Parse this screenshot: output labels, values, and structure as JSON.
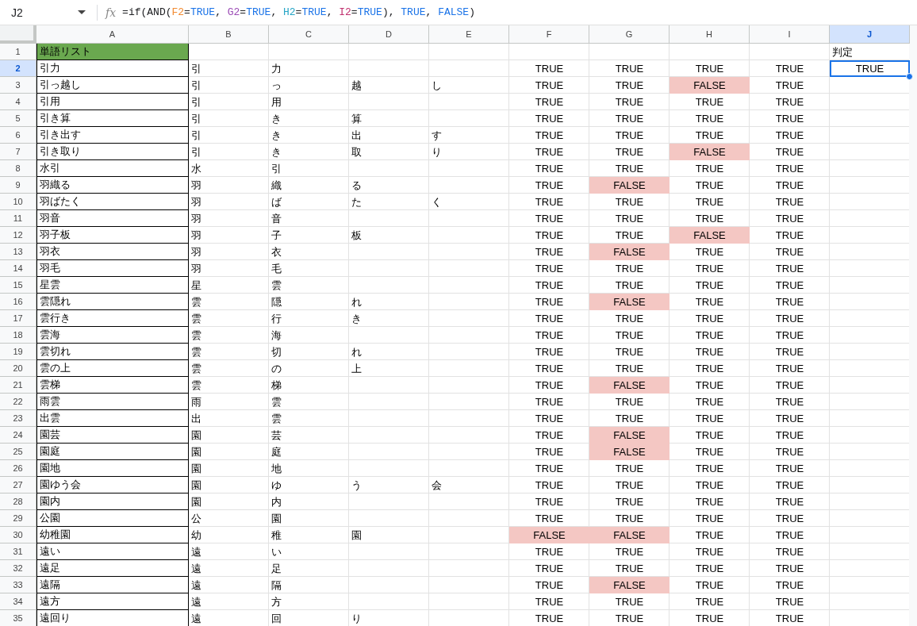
{
  "name_box": {
    "value": "J2"
  },
  "formula_bar": {
    "fx_label": "fx",
    "tokens": [
      {
        "text": "=if(AND("
      },
      {
        "text": "F2",
        "color": "#f28b31"
      },
      {
        "text": "="
      },
      {
        "text": "TRUE",
        "color": "#1a73e8"
      },
      {
        "text": ", "
      },
      {
        "text": "G2",
        "color": "#9c4cb6"
      },
      {
        "text": "="
      },
      {
        "text": "TRUE",
        "color": "#1a73e8"
      },
      {
        "text": ", "
      },
      {
        "text": "H2",
        "color": "#26a5c6"
      },
      {
        "text": "="
      },
      {
        "text": "TRUE",
        "color": "#1a73e8"
      },
      {
        "text": ", "
      },
      {
        "text": "I2",
        "color": "#c0306e"
      },
      {
        "text": "="
      },
      {
        "text": "TRUE",
        "color": "#1a73e8"
      },
      {
        "text": "), "
      },
      {
        "text": "TRUE",
        "color": "#1a73e8"
      },
      {
        "text": ", "
      },
      {
        "text": "FALSE",
        "color": "#1a73e8"
      },
      {
        "text": ")"
      }
    ]
  },
  "columns": [
    {
      "label": "A",
      "selected": false
    },
    {
      "label": "B",
      "selected": false
    },
    {
      "label": "C",
      "selected": false
    },
    {
      "label": "D",
      "selected": false
    },
    {
      "label": "E",
      "selected": false
    },
    {
      "label": "F",
      "selected": false
    },
    {
      "label": "G",
      "selected": false
    },
    {
      "label": "H",
      "selected": false
    },
    {
      "label": "I",
      "selected": false
    },
    {
      "label": "J",
      "selected": true
    }
  ],
  "title_row": {
    "number": "1",
    "selected": false,
    "title": "単語リスト",
    "label": "判定"
  },
  "rows": [
    {
      "number": "2",
      "selected": true,
      "word": "引力",
      "parts": [
        "引",
        "力"
      ],
      "checks": [
        {
          "text": "TRUE",
          "highlighted": false
        },
        {
          "text": "TRUE",
          "highlighted": false
        },
        {
          "text": "TRUE",
          "highlighted": false
        },
        {
          "text": "TRUE",
          "highlighted": false
        }
      ],
      "result": "TRUE"
    },
    {
      "number": "3",
      "selected": false,
      "word": "引っ越し",
      "parts": [
        "引",
        "っ",
        "越",
        "し"
      ],
      "checks": [
        {
          "text": "TRUE",
          "highlighted": false
        },
        {
          "text": "TRUE",
          "highlighted": false
        },
        {
          "text": "FALSE",
          "highlighted": true
        },
        {
          "text": "TRUE",
          "highlighted": false
        }
      ]
    },
    {
      "number": "4",
      "selected": false,
      "word": "引用",
      "parts": [
        "引",
        "用"
      ],
      "checks": [
        {
          "text": "TRUE",
          "highlighted": false
        },
        {
          "text": "TRUE",
          "highlighted": false
        },
        {
          "text": "TRUE",
          "highlighted": false
        },
        {
          "text": "TRUE",
          "highlighted": false
        }
      ]
    },
    {
      "number": "5",
      "selected": false,
      "word": "引き算",
      "parts": [
        "引",
        "き",
        "算"
      ],
      "checks": [
        {
          "text": "TRUE",
          "highlighted": false
        },
        {
          "text": "TRUE",
          "highlighted": false
        },
        {
          "text": "TRUE",
          "highlighted": false
        },
        {
          "text": "TRUE",
          "highlighted": false
        }
      ]
    },
    {
      "number": "6",
      "selected": false,
      "word": "引き出す",
      "parts": [
        "引",
        "き",
        "出",
        "す"
      ],
      "checks": [
        {
          "text": "TRUE",
          "highlighted": false
        },
        {
          "text": "TRUE",
          "highlighted": false
        },
        {
          "text": "TRUE",
          "highlighted": false
        },
        {
          "text": "TRUE",
          "highlighted": false
        }
      ]
    },
    {
      "number": "7",
      "selected": false,
      "word": "引き取り",
      "parts": [
        "引",
        "き",
        "取",
        "り"
      ],
      "checks": [
        {
          "text": "TRUE",
          "highlighted": false
        },
        {
          "text": "TRUE",
          "highlighted": false
        },
        {
          "text": "FALSE",
          "highlighted": true
        },
        {
          "text": "TRUE",
          "highlighted": false
        }
      ]
    },
    {
      "number": "8",
      "selected": false,
      "word": "水引",
      "parts": [
        "水",
        "引"
      ],
      "checks": [
        {
          "text": "TRUE",
          "highlighted": false
        },
        {
          "text": "TRUE",
          "highlighted": false
        },
        {
          "text": "TRUE",
          "highlighted": false
        },
        {
          "text": "TRUE",
          "highlighted": false
        }
      ]
    },
    {
      "number": "9",
      "selected": false,
      "word": "羽織る",
      "parts": [
        "羽",
        "織",
        "る"
      ],
      "checks": [
        {
          "text": "TRUE",
          "highlighted": false
        },
        {
          "text": "FALSE",
          "highlighted": true
        },
        {
          "text": "TRUE",
          "highlighted": false
        },
        {
          "text": "TRUE",
          "highlighted": false
        }
      ]
    },
    {
      "number": "10",
      "selected": false,
      "word": "羽ばたく",
      "parts": [
        "羽",
        "ば",
        "た",
        "く"
      ],
      "checks": [
        {
          "text": "TRUE",
          "highlighted": false
        },
        {
          "text": "TRUE",
          "highlighted": false
        },
        {
          "text": "TRUE",
          "highlighted": false
        },
        {
          "text": "TRUE",
          "highlighted": false
        }
      ]
    },
    {
      "number": "11",
      "selected": false,
      "word": "羽音",
      "parts": [
        "羽",
        "音"
      ],
      "checks": [
        {
          "text": "TRUE",
          "highlighted": false
        },
        {
          "text": "TRUE",
          "highlighted": false
        },
        {
          "text": "TRUE",
          "highlighted": false
        },
        {
          "text": "TRUE",
          "highlighted": false
        }
      ]
    },
    {
      "number": "12",
      "selected": false,
      "word": "羽子板",
      "parts": [
        "羽",
        "子",
        "板"
      ],
      "checks": [
        {
          "text": "TRUE",
          "highlighted": false
        },
        {
          "text": "TRUE",
          "highlighted": false
        },
        {
          "text": "FALSE",
          "highlighted": true
        },
        {
          "text": "TRUE",
          "highlighted": false
        }
      ]
    },
    {
      "number": "13",
      "selected": false,
      "word": "羽衣",
      "parts": [
        "羽",
        "衣"
      ],
      "checks": [
        {
          "text": "TRUE",
          "highlighted": false
        },
        {
          "text": "FALSE",
          "highlighted": true
        },
        {
          "text": "TRUE",
          "highlighted": false
        },
        {
          "text": "TRUE",
          "highlighted": false
        }
      ]
    },
    {
      "number": "14",
      "selected": false,
      "word": "羽毛",
      "parts": [
        "羽",
        "毛"
      ],
      "checks": [
        {
          "text": "TRUE",
          "highlighted": false
        },
        {
          "text": "TRUE",
          "highlighted": false
        },
        {
          "text": "TRUE",
          "highlighted": false
        },
        {
          "text": "TRUE",
          "highlighted": false
        }
      ]
    },
    {
      "number": "15",
      "selected": false,
      "word": "星雲",
      "parts": [
        "星",
        "雲"
      ],
      "checks": [
        {
          "text": "TRUE",
          "highlighted": false
        },
        {
          "text": "TRUE",
          "highlighted": false
        },
        {
          "text": "TRUE",
          "highlighted": false
        },
        {
          "text": "TRUE",
          "highlighted": false
        }
      ]
    },
    {
      "number": "16",
      "selected": false,
      "word": "雲隠れ",
      "parts": [
        "雲",
        "隠",
        "れ"
      ],
      "checks": [
        {
          "text": "TRUE",
          "highlighted": false
        },
        {
          "text": "FALSE",
          "highlighted": true
        },
        {
          "text": "TRUE",
          "highlighted": false
        },
        {
          "text": "TRUE",
          "highlighted": false
        }
      ]
    },
    {
      "number": "17",
      "selected": false,
      "word": "雲行き",
      "parts": [
        "雲",
        "行",
        "き"
      ],
      "checks": [
        {
          "text": "TRUE",
          "highlighted": false
        },
        {
          "text": "TRUE",
          "highlighted": false
        },
        {
          "text": "TRUE",
          "highlighted": false
        },
        {
          "text": "TRUE",
          "highlighted": false
        }
      ]
    },
    {
      "number": "18",
      "selected": false,
      "word": "雲海",
      "parts": [
        "雲",
        "海"
      ],
      "checks": [
        {
          "text": "TRUE",
          "highlighted": false
        },
        {
          "text": "TRUE",
          "highlighted": false
        },
        {
          "text": "TRUE",
          "highlighted": false
        },
        {
          "text": "TRUE",
          "highlighted": false
        }
      ]
    },
    {
      "number": "19",
      "selected": false,
      "word": "雲切れ",
      "parts": [
        "雲",
        "切",
        "れ"
      ],
      "checks": [
        {
          "text": "TRUE",
          "highlighted": false
        },
        {
          "text": "TRUE",
          "highlighted": false
        },
        {
          "text": "TRUE",
          "highlighted": false
        },
        {
          "text": "TRUE",
          "highlighted": false
        }
      ]
    },
    {
      "number": "20",
      "selected": false,
      "word": "雲の上",
      "parts": [
        "雲",
        "の",
        "上"
      ],
      "checks": [
        {
          "text": "TRUE",
          "highlighted": false
        },
        {
          "text": "TRUE",
          "highlighted": false
        },
        {
          "text": "TRUE",
          "highlighted": false
        },
        {
          "text": "TRUE",
          "highlighted": false
        }
      ]
    },
    {
      "number": "21",
      "selected": false,
      "word": "雲梯",
      "parts": [
        "雲",
        "梯"
      ],
      "checks": [
        {
          "text": "TRUE",
          "highlighted": false
        },
        {
          "text": "FALSE",
          "highlighted": true
        },
        {
          "text": "TRUE",
          "highlighted": false
        },
        {
          "text": "TRUE",
          "highlighted": false
        }
      ]
    },
    {
      "number": "22",
      "selected": false,
      "word": "雨雲",
      "parts": [
        "雨",
        "雲"
      ],
      "checks": [
        {
          "text": "TRUE",
          "highlighted": false
        },
        {
          "text": "TRUE",
          "highlighted": false
        },
        {
          "text": "TRUE",
          "highlighted": false
        },
        {
          "text": "TRUE",
          "highlighted": false
        }
      ]
    },
    {
      "number": "23",
      "selected": false,
      "word": "出雲",
      "parts": [
        "出",
        "雲"
      ],
      "checks": [
        {
          "text": "TRUE",
          "highlighted": false
        },
        {
          "text": "TRUE",
          "highlighted": false
        },
        {
          "text": "TRUE",
          "highlighted": false
        },
        {
          "text": "TRUE",
          "highlighted": false
        }
      ]
    },
    {
      "number": "24",
      "selected": false,
      "word": "園芸",
      "parts": [
        "園",
        "芸"
      ],
      "checks": [
        {
          "text": "TRUE",
          "highlighted": false
        },
        {
          "text": "FALSE",
          "highlighted": true
        },
        {
          "text": "TRUE",
          "highlighted": false
        },
        {
          "text": "TRUE",
          "highlighted": false
        }
      ]
    },
    {
      "number": "25",
      "selected": false,
      "word": "園庭",
      "parts": [
        "園",
        "庭"
      ],
      "checks": [
        {
          "text": "TRUE",
          "highlighted": false
        },
        {
          "text": "FALSE",
          "highlighted": true
        },
        {
          "text": "TRUE",
          "highlighted": false
        },
        {
          "text": "TRUE",
          "highlighted": false
        }
      ]
    },
    {
      "number": "26",
      "selected": false,
      "word": "園地",
      "parts": [
        "園",
        "地"
      ],
      "checks": [
        {
          "text": "TRUE",
          "highlighted": false
        },
        {
          "text": "TRUE",
          "highlighted": false
        },
        {
          "text": "TRUE",
          "highlighted": false
        },
        {
          "text": "TRUE",
          "highlighted": false
        }
      ]
    },
    {
      "number": "27",
      "selected": false,
      "word": "園ゆう会",
      "parts": [
        "園",
        "ゆ",
        "う",
        "会"
      ],
      "checks": [
        {
          "text": "TRUE",
          "highlighted": false
        },
        {
          "text": "TRUE",
          "highlighted": false
        },
        {
          "text": "TRUE",
          "highlighted": false
        },
        {
          "text": "TRUE",
          "highlighted": false
        }
      ]
    },
    {
      "number": "28",
      "selected": false,
      "word": "園内",
      "parts": [
        "園",
        "内"
      ],
      "checks": [
        {
          "text": "TRUE",
          "highlighted": false
        },
        {
          "text": "TRUE",
          "highlighted": false
        },
        {
          "text": "TRUE",
          "highlighted": false
        },
        {
          "text": "TRUE",
          "highlighted": false
        }
      ]
    },
    {
      "number": "29",
      "selected": false,
      "word": "公園",
      "parts": [
        "公",
        "園"
      ],
      "checks": [
        {
          "text": "TRUE",
          "highlighted": false
        },
        {
          "text": "TRUE",
          "highlighted": false
        },
        {
          "text": "TRUE",
          "highlighted": false
        },
        {
          "text": "TRUE",
          "highlighted": false
        }
      ]
    },
    {
      "number": "30",
      "selected": false,
      "word": "幼稚園",
      "parts": [
        "幼",
        "稚",
        "園"
      ],
      "checks": [
        {
          "text": "FALSE",
          "highlighted": true
        },
        {
          "text": "FALSE",
          "highlighted": true
        },
        {
          "text": "TRUE",
          "highlighted": false
        },
        {
          "text": "TRUE",
          "highlighted": false
        }
      ]
    },
    {
      "number": "31",
      "selected": false,
      "word": "遠い",
      "parts": [
        "遠",
        "い"
      ],
      "checks": [
        {
          "text": "TRUE",
          "highlighted": false
        },
        {
          "text": "TRUE",
          "highlighted": false
        },
        {
          "text": "TRUE",
          "highlighted": false
        },
        {
          "text": "TRUE",
          "highlighted": false
        }
      ]
    },
    {
      "number": "32",
      "selected": false,
      "word": "遠足",
      "parts": [
        "遠",
        "足"
      ],
      "checks": [
        {
          "text": "TRUE",
          "highlighted": false
        },
        {
          "text": "TRUE",
          "highlighted": false
        },
        {
          "text": "TRUE",
          "highlighted": false
        },
        {
          "text": "TRUE",
          "highlighted": false
        }
      ]
    },
    {
      "number": "33",
      "selected": false,
      "word": "遠隔",
      "parts": [
        "遠",
        "隔"
      ],
      "checks": [
        {
          "text": "TRUE",
          "highlighted": false
        },
        {
          "text": "FALSE",
          "highlighted": true
        },
        {
          "text": "TRUE",
          "highlighted": false
        },
        {
          "text": "TRUE",
          "highlighted": false
        }
      ]
    },
    {
      "number": "34",
      "selected": false,
      "word": "遠方",
      "parts": [
        "遠",
        "方"
      ],
      "checks": [
        {
          "text": "TRUE",
          "highlighted": false
        },
        {
          "text": "TRUE",
          "highlighted": false
        },
        {
          "text": "TRUE",
          "highlighted": false
        },
        {
          "text": "TRUE",
          "highlighted": false
        }
      ]
    },
    {
      "number": "35",
      "selected": false,
      "word": "遠回り",
      "parts": [
        "遠",
        "回",
        "り"
      ],
      "checks": [
        {
          "text": "TRUE",
          "highlighted": false
        },
        {
          "text": "TRUE",
          "highlighted": false
        },
        {
          "text": "TRUE",
          "highlighted": false
        },
        {
          "text": "TRUE",
          "highlighted": false
        }
      ]
    }
  ]
}
